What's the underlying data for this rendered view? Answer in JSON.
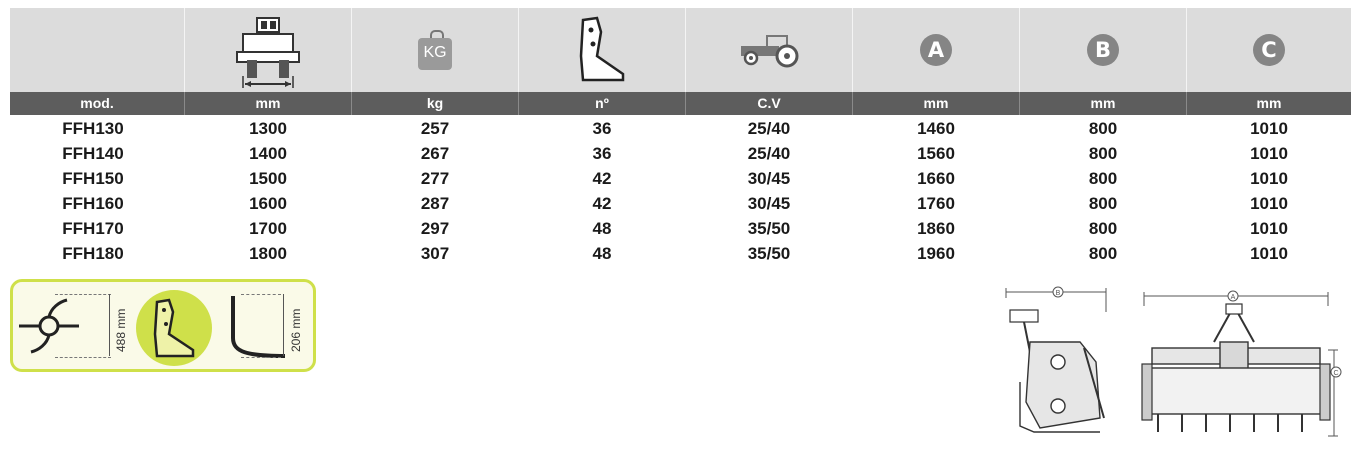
{
  "header": {
    "icons": [
      "tractor-width-icon",
      "weight-kg-icon",
      "blade-icon",
      "tractor-icon",
      "dimension-a-icon",
      "dimension-b-icon",
      "dimension-c-icon"
    ],
    "weight_label": "KG",
    "letters": [
      "A",
      "B",
      "C"
    ]
  },
  "units": [
    "mod.",
    "mm",
    "kg",
    "nº",
    "C.V",
    "mm",
    "mm",
    "mm"
  ],
  "rows": [
    [
      "FFH130",
      "1300",
      "257",
      "36",
      "25/40",
      "1460",
      "800",
      "1010"
    ],
    [
      "FFH140",
      "1400",
      "267",
      "36",
      "25/40",
      "1560",
      "800",
      "1010"
    ],
    [
      "FFH150",
      "1500",
      "277",
      "42",
      "30/45",
      "1660",
      "800",
      "1010"
    ],
    [
      "FFH160",
      "1600",
      "287",
      "42",
      "30/45",
      "1760",
      "800",
      "1010"
    ],
    [
      "FFH170",
      "1700",
      "297",
      "48",
      "35/50",
      "1860",
      "800",
      "1010"
    ],
    [
      "FFH180",
      "1800",
      "307",
      "48",
      "35/50",
      "1960",
      "800",
      "1010"
    ]
  ],
  "blade_box": {
    "left_dimension": "488 mm",
    "right_dimension": "206 mm",
    "accent_color": "#cfe04a"
  },
  "diagram": {
    "side_label": "B",
    "front_top_label": "A",
    "front_right_label": "C"
  },
  "colors": {
    "header_bg": "#dcdcdc",
    "unit_bar_bg": "#5d5d5d",
    "letter_circle": "#858585",
    "accent": "#cfe04a"
  }
}
